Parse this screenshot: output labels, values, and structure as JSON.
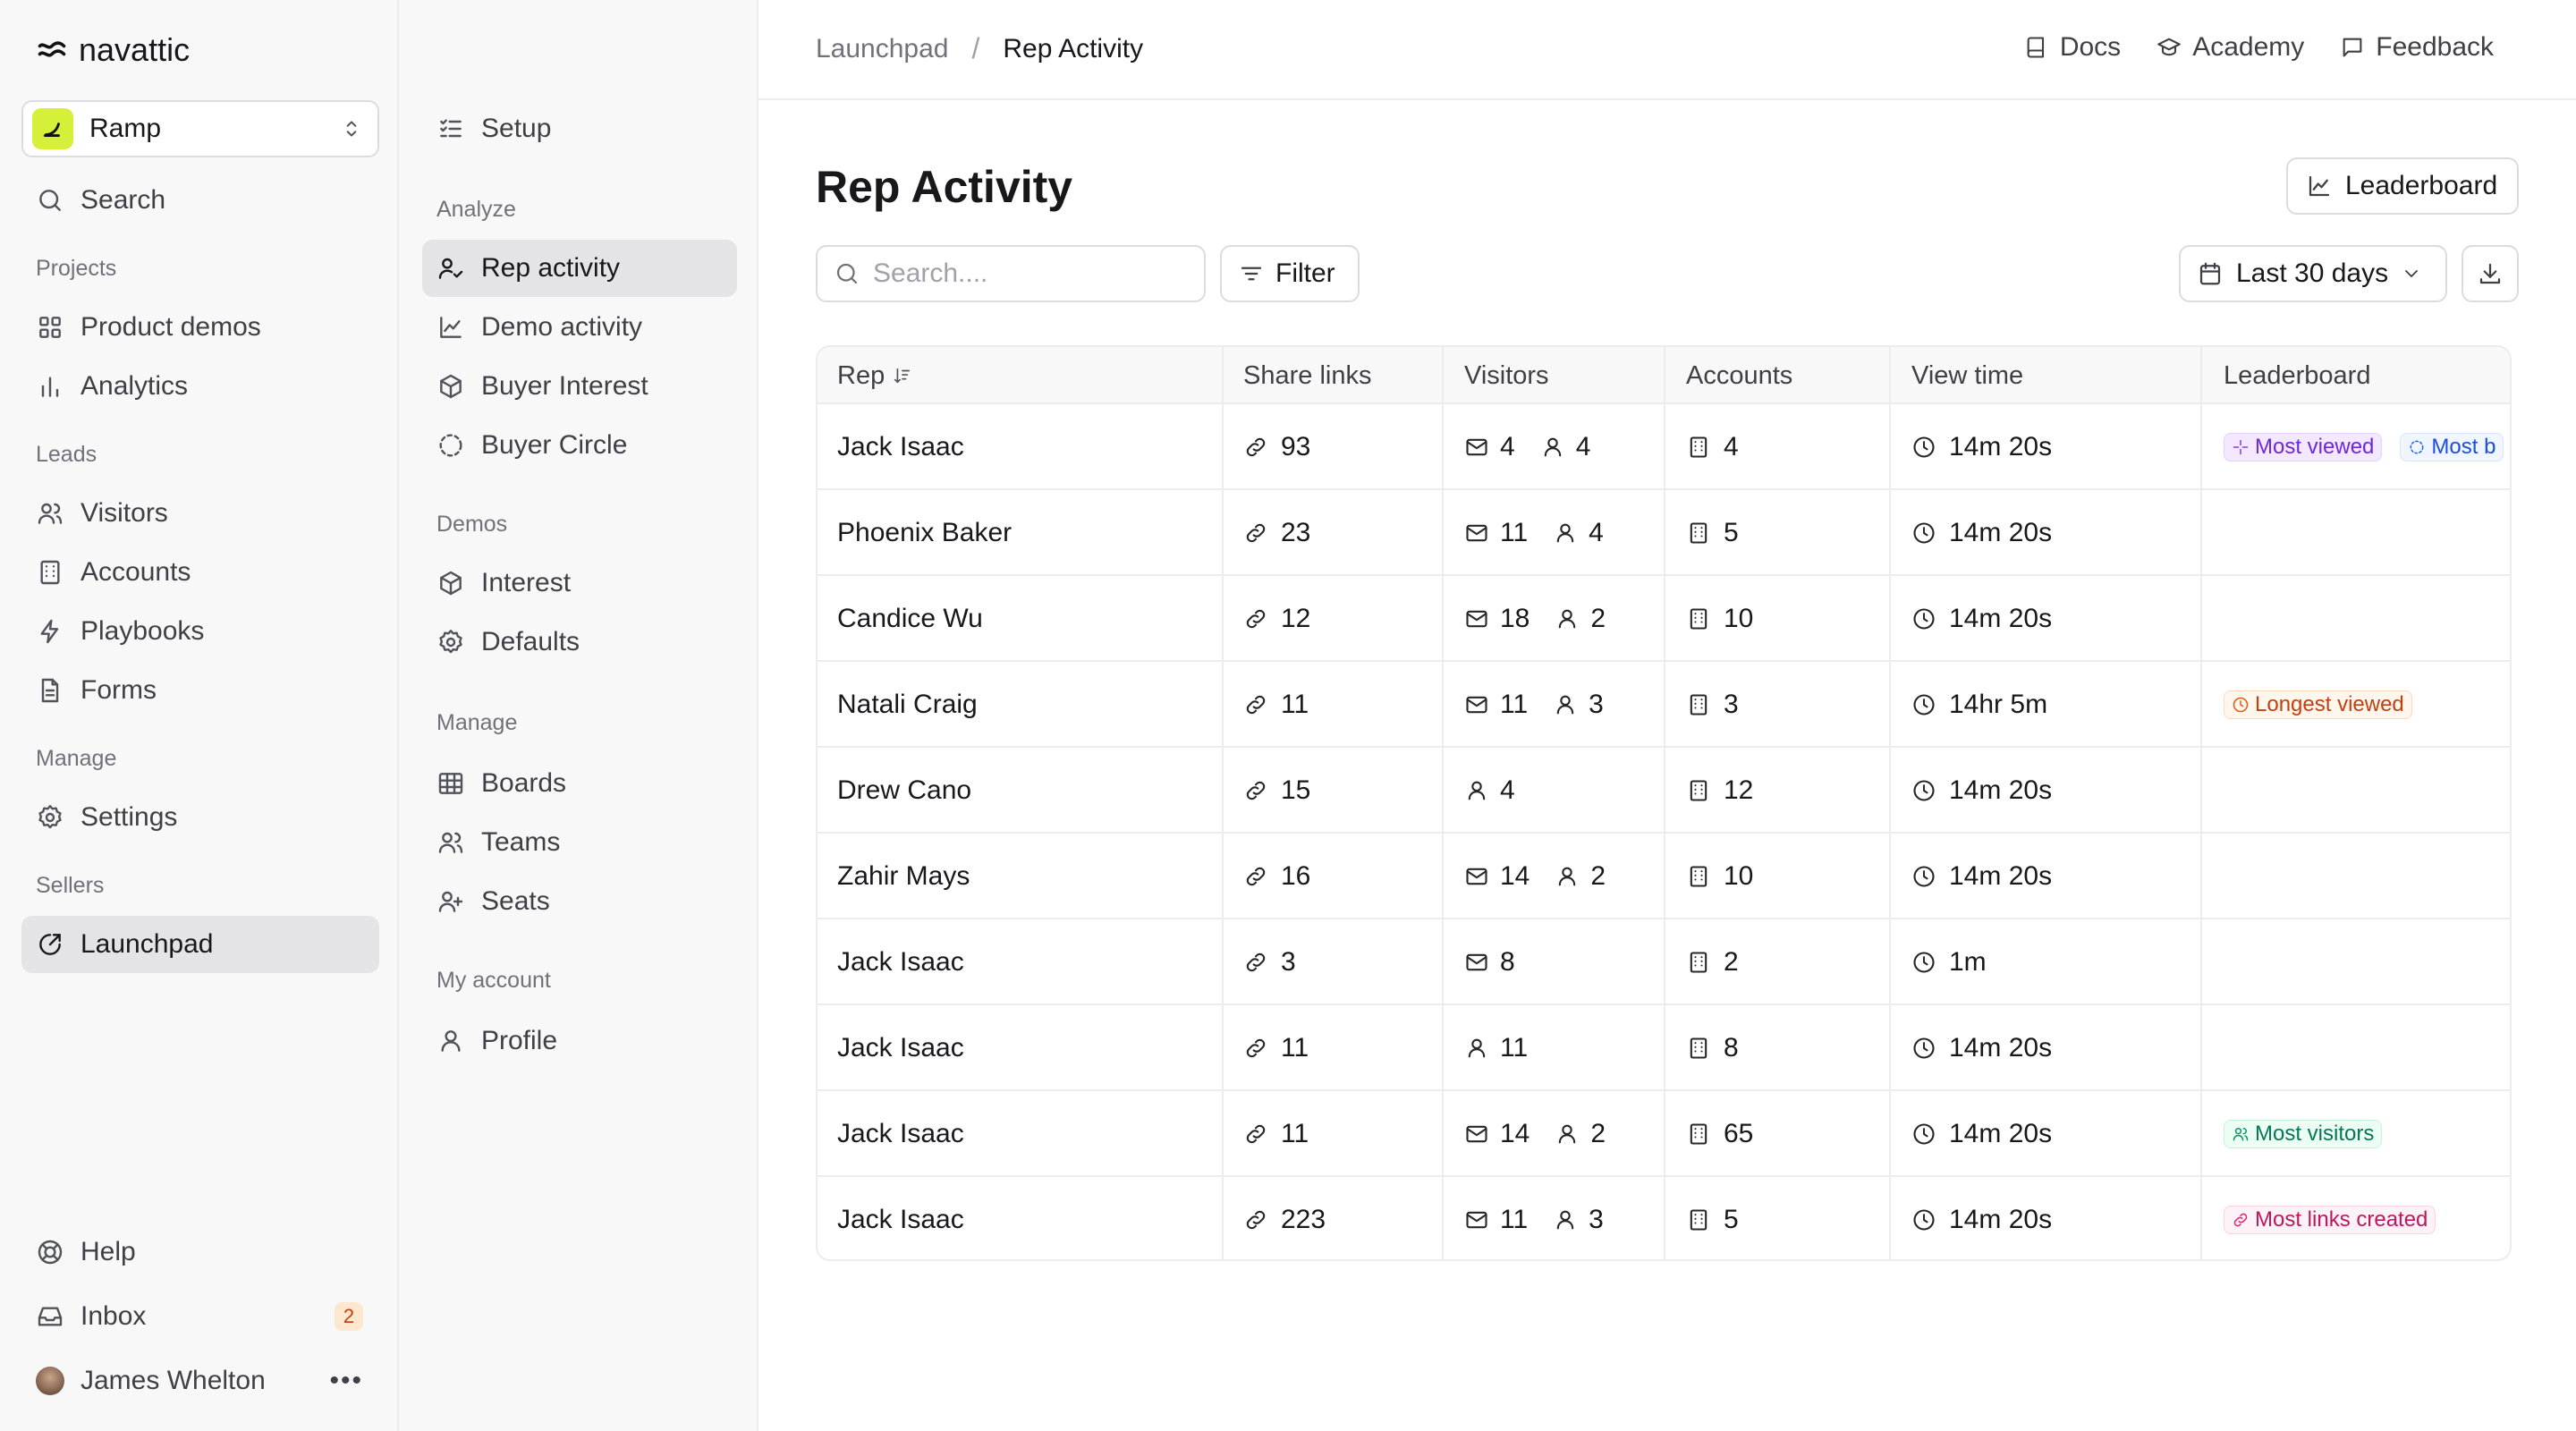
{
  "brand": {
    "name": "navattic"
  },
  "workspace": {
    "name": "Ramp"
  },
  "sidebar": {
    "search_label": "Search",
    "sections": {
      "projects": "Projects",
      "leads": "Leads",
      "manage": "Manage",
      "sellers": "Sellers"
    },
    "items": {
      "product_demos": "Product demos",
      "analytics": "Analytics",
      "visitors": "Visitors",
      "accounts": "Accounts",
      "playbooks": "Playbooks",
      "forms": "Forms",
      "settings": "Settings",
      "launchpad": "Launchpad"
    },
    "help": "Help",
    "inbox": {
      "label": "Inbox",
      "count": "2"
    },
    "user": {
      "name": "James Whelton"
    }
  },
  "subnav": {
    "setup": "Setup",
    "sections": {
      "analyze": "Analyze",
      "demos": "Demos",
      "manage": "Manage",
      "account": "My account"
    },
    "items": {
      "rep_activity": "Rep activity",
      "demo_activity": "Demo activity",
      "buyer_interest": "Buyer Interest",
      "buyer_circle": "Buyer Circle",
      "interest": "Interest",
      "defaults": "Defaults",
      "boards": "Boards",
      "teams": "Teams",
      "seats": "Seats",
      "profile": "Profile"
    }
  },
  "breadcrumb": {
    "parent": "Launchpad",
    "separator": "/",
    "current": "Rep Activity"
  },
  "toplinks": {
    "docs": "Docs",
    "academy": "Academy",
    "feedback": "Feedback"
  },
  "page": {
    "title": "Rep Activity",
    "leaderboard_button": "Leaderboard",
    "search_placeholder": "Search....",
    "filter_label": "Filter",
    "date_range": "Last 30 days"
  },
  "table": {
    "columns": {
      "rep": "Rep",
      "share_links": "Share links",
      "visitors": "Visitors",
      "accounts": "Accounts",
      "view_time": "View time",
      "leaderboard": "Leaderboard"
    },
    "rows": [
      {
        "rep": "Jack Isaac",
        "links": "93",
        "emails": "4",
        "people": "4",
        "accounts": "4",
        "time": "14m 20s"
      },
      {
        "rep": "Phoenix Baker",
        "links": "23",
        "emails": "11",
        "people": "4",
        "accounts": "5",
        "time": "14m 20s"
      },
      {
        "rep": "Candice Wu",
        "links": "12",
        "emails": "18",
        "people": "2",
        "accounts": "10",
        "time": "14m 20s"
      },
      {
        "rep": "Natali Craig",
        "links": "11",
        "emails": "11",
        "people": "3",
        "accounts": "3",
        "time": "14hr 5m"
      },
      {
        "rep": "Drew Cano",
        "links": "15",
        "people": "4",
        "accounts": "12",
        "time": "14m 20s"
      },
      {
        "rep": "Zahir Mays",
        "links": "16",
        "emails": "14",
        "people": "2",
        "accounts": "10",
        "time": "14m 20s"
      },
      {
        "rep": "Jack Isaac",
        "links": "3",
        "emails": "8",
        "accounts": "2",
        "time": "1m"
      },
      {
        "rep": "Jack Isaac",
        "links": "11",
        "people": "11",
        "accounts": "8",
        "time": "14m 20s"
      },
      {
        "rep": "Jack Isaac",
        "links": "11",
        "emails": "14",
        "people": "2",
        "accounts": "65",
        "time": "14m 20s"
      },
      {
        "rep": "Jack Isaac",
        "links": "223",
        "emails": "11",
        "people": "3",
        "accounts": "5",
        "time": "14m 20s"
      }
    ],
    "badges": {
      "most_viewed": "Most viewed",
      "most_b": "Most b",
      "longest_viewed": "Longest viewed",
      "most_visitors": "Most visitors",
      "most_links_created": "Most links created"
    }
  }
}
